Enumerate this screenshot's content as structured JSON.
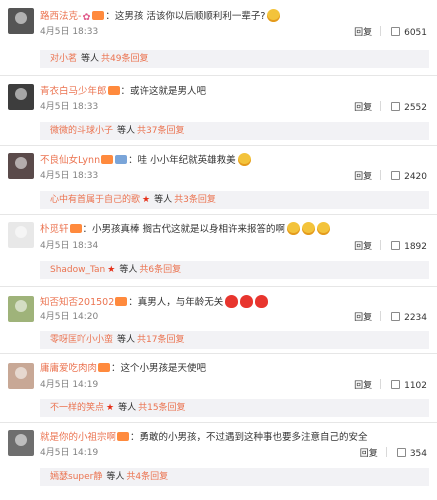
{
  "comments": [
    {
      "username": "路西法克-",
      "text": "：这男孩  活该你以后顺顺利利一辈子?",
      "emojis": [
        "grin-face"
      ],
      "time": "4月5日 18:33",
      "reply_label": "回复",
      "likes": "6051",
      "sub_user": "对小茗",
      "sub_others": "等人",
      "sub_total": "共49条回复"
    },
    {
      "username": "青衣白马少年郎",
      "text": "：或许这就是男人吧",
      "emojis": [],
      "time": "4月5日 18:33",
      "reply_label": "回复",
      "likes": "2552",
      "sub_user": "微微的斗球小子",
      "sub_others": "等人",
      "sub_total": "共37条回复"
    },
    {
      "username": "不良仙女Lynn",
      "text": "：哇 小小年纪就英雄救美",
      "emojis": [
        "cat-face"
      ],
      "time": "4月5日 18:33",
      "reply_label": "回复",
      "likes": "2420",
      "sub_user": "心中有首属于自己的歌",
      "sub_others": "等人",
      "sub_total": "共3条回复"
    },
    {
      "username": "朴觅轩",
      "text": "：小男孩真棒 搁古代这就是以身相许来报答的啊",
      "emojis": [
        "blush-face",
        "blush-face",
        "blush-face"
      ],
      "time": "4月5日 18:34",
      "reply_label": "回复",
      "likes": "1892",
      "sub_user": "Shadow_Tan",
      "sub_others": "等人",
      "sub_total": "共6条回复"
    },
    {
      "username": "知否知否201502",
      "text": "：真男人，与年龄无关",
      "emojis": [
        "heart",
        "heart",
        "heart"
      ],
      "time": "4月5日 14:20",
      "reply_label": "回复",
      "likes": "2234",
      "sub_user": "零呀匡吖小小蛮",
      "sub_others": "等人",
      "sub_total": "共17条回复"
    },
    {
      "username": "庸庸爱吃肉肉",
      "text": "：这个小男孩是天使吧",
      "emojis": [],
      "time": "4月5日 14:19",
      "reply_label": "回复",
      "likes": "1102",
      "sub_user": "不一样的笑点",
      "sub_others": "等人",
      "sub_total": "共15条回复"
    },
    {
      "username": "就是你的小祖宗啊",
      "text": "：勇敢的小男孩，不过遇到这种事也要多注意自己的安全",
      "emojis": [],
      "time": "4月5日 14:19",
      "reply_label": "回复",
      "likes": "354",
      "sub_user": "嫣瑟super静",
      "sub_others": "等人",
      "sub_total": "共4条回复"
    }
  ]
}
